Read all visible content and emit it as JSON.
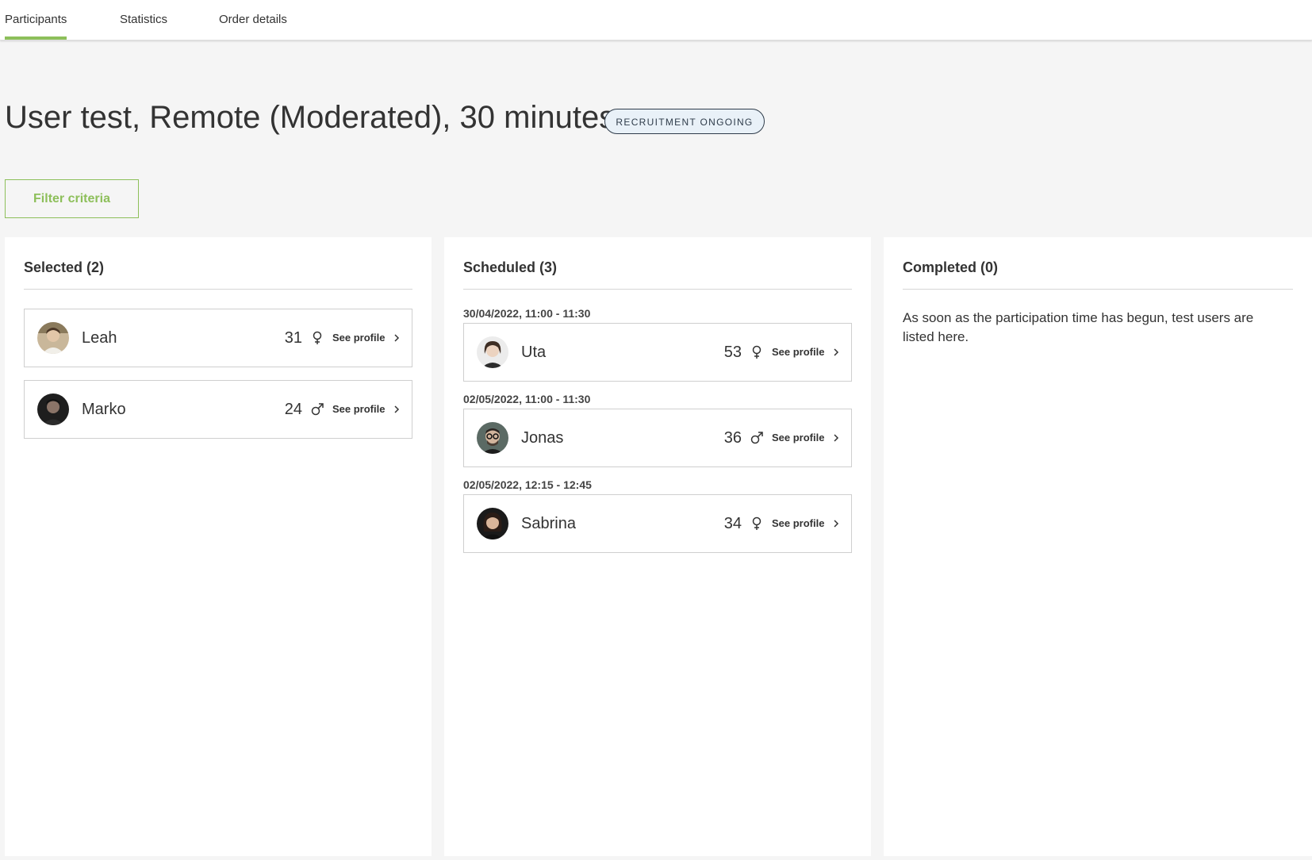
{
  "nav": {
    "tabs": [
      {
        "label": "Participants",
        "active": true
      },
      {
        "label": "Statistics",
        "active": false
      },
      {
        "label": "Order details",
        "active": false
      }
    ]
  },
  "page": {
    "title": "User test, Remote (Moderated), 30 minutes",
    "status_badge": "RECRUITMENT ONGOING",
    "filter_button": "Filter criteria"
  },
  "colors": {
    "accent": "#8dbf5a",
    "badge_border": "#2f3c4a",
    "badge_bg": "#e9f1f8"
  },
  "columns": {
    "selected": {
      "header": "Selected (2)",
      "participants": [
        {
          "name": "Leah",
          "age": "31",
          "gender_icon": "female-icon",
          "action": "See profile"
        },
        {
          "name": "Marko",
          "age": "24",
          "gender_icon": "male-icon",
          "action": "See profile"
        }
      ]
    },
    "scheduled": {
      "header": "Scheduled (3)",
      "slots": [
        {
          "time": "30/04/2022, 11:00 - 11:30",
          "participant": {
            "name": "Uta",
            "age": "53",
            "gender_icon": "female-icon",
            "action": "See profile"
          }
        },
        {
          "time": "02/05/2022, 11:00 - 11:30",
          "participant": {
            "name": "Jonas",
            "age": "36",
            "gender_icon": "male-icon",
            "action": "See profile"
          }
        },
        {
          "time": "02/05/2022, 12:15 - 12:45",
          "participant": {
            "name": "Sabrina",
            "age": "34",
            "gender_icon": "female-icon",
            "action": "See profile"
          }
        }
      ]
    },
    "completed": {
      "header": "Completed (0)",
      "empty_message": "As soon as the participation time has begun, test users are listed here."
    }
  }
}
